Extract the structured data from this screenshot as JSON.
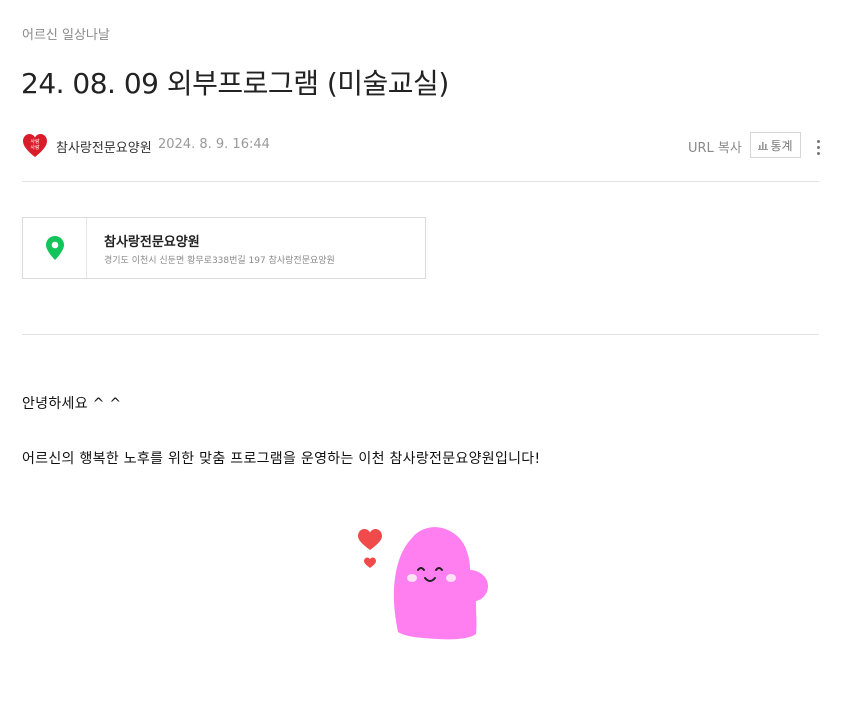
{
  "post": {
    "category": "어르신 일상나날",
    "title": "24. 08. 09 외부프로그램 (미술교실)",
    "author": "참사랑전문요양원",
    "date": "2024. 8. 9. 16:44",
    "url_copy": "URL 복사",
    "stats": "통계"
  },
  "place": {
    "name": "참사랑전문요양원",
    "address": "경기도 이천시 신둔면 황무로338번길 197 참사랑전문요양원"
  },
  "body": {
    "greeting": "안녕하세요 ^ ^",
    "intro": "어르신의 행복한 노후를 위한 맞춤 프로그램을 운영하는 이천 참사랑전문요양원입니다!"
  },
  "colors": {
    "pin": "#12c45a",
    "sticker": "#ff7ef0",
    "heart": "#f04a4a",
    "avatar": "#d81c2a"
  },
  "icons": {
    "avatar": "heart-logo",
    "stats": "bar-chart-icon",
    "more": "kebab-icon",
    "pin": "map-pin-icon",
    "sticker": "pink-character-sticker"
  }
}
